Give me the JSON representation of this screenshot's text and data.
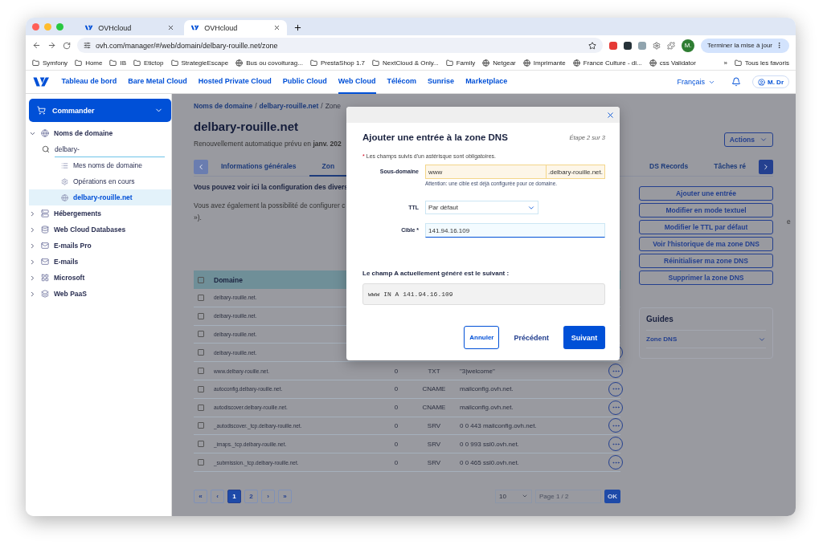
{
  "browser": {
    "tabs": [
      {
        "title": "OVHcloud",
        "selected": false
      },
      {
        "title": "OVHcloud",
        "selected": true
      }
    ],
    "url": "ovh.com/manager/#/web/domain/delbary-rouille.net/zone",
    "update_button": "Terminer la mise à jour",
    "profile_initial": "M.",
    "bookmarks": [
      {
        "label": "Symfony",
        "kind": "folder"
      },
      {
        "label": "Home",
        "kind": "folder"
      },
      {
        "label": "IB",
        "kind": "folder"
      },
      {
        "label": "Etictop",
        "kind": "folder"
      },
      {
        "label": "StrategieEscape",
        "kind": "folder"
      },
      {
        "label": "Bus ou covoiturag...",
        "kind": "site"
      },
      {
        "label": "PrestaShop 1.7",
        "kind": "folder"
      },
      {
        "label": "NextCloud & Only...",
        "kind": "folder"
      },
      {
        "label": "Family",
        "kind": "folder"
      },
      {
        "label": "Netgear",
        "kind": "site"
      },
      {
        "label": "Imprimante",
        "kind": "site"
      },
      {
        "label": "France Culture - di...",
        "kind": "site"
      },
      {
        "label": "css Validator",
        "kind": "site"
      }
    ],
    "more_bookmarks": "»",
    "all_bookmarks": "Tous les favoris"
  },
  "nav": {
    "items": [
      {
        "label": "Tableau de bord",
        "selected": false
      },
      {
        "label": "Bare Metal Cloud",
        "selected": false
      },
      {
        "label": "Hosted Private Cloud",
        "selected": false
      },
      {
        "label": "Public Cloud",
        "selected": false
      },
      {
        "label": "Web Cloud",
        "selected": true
      },
      {
        "label": "Télécom",
        "selected": false
      },
      {
        "label": "Sunrise",
        "selected": false
      },
      {
        "label": "Marketplace",
        "selected": false
      }
    ],
    "language": "Français",
    "user": "M. Dr"
  },
  "sidebar": {
    "order_button": "Commander",
    "items": [
      {
        "label": "Noms de domaine",
        "expanded": true,
        "search_value": "delbary-",
        "children": [
          {
            "label": "Mes noms de domaine",
            "selected": false
          },
          {
            "label": "Opérations en cours",
            "selected": false
          },
          {
            "label": "delbary-rouille.net",
            "selected": true
          }
        ]
      },
      {
        "label": "Hébergements",
        "expanded": false
      },
      {
        "label": "Web Cloud Databases",
        "expanded": false
      },
      {
        "label": "E-mails Pro",
        "expanded": false
      },
      {
        "label": "E-mails",
        "expanded": false
      },
      {
        "label": "Microsoft",
        "expanded": false
      },
      {
        "label": "Web PaaS",
        "expanded": false
      }
    ]
  },
  "breadcrumb": {
    "items": [
      "Noms de domaine",
      "delbary-rouille.net",
      "Zone"
    ],
    "separator": "/"
  },
  "title": "delbary-rouille.net",
  "renewal": "Renouvellement automatique prévu en **janv. 202**",
  "actions_button": "Actions",
  "tabs": [
    {
      "label": "Informations générales",
      "selected": false
    },
    {
      "label": "Zon",
      "selected": true
    },
    {
      "label": "DS Records",
      "selected": false
    },
    {
      "label": "Tâches ré",
      "selected": false
    }
  ],
  "intro_bold": "Vous pouvez voir ici la configuration des divers",
  "intro_text": "Vous avez également la possibilité de configurer c",
  "intro_text_end": "»).",
  "intro_right": "e",
  "table": {
    "columns": [
      "Domaine"
    ],
    "header_checked": false,
    "rows": [
      {
        "domain": "delbary-rouille.net.",
        "checked": false,
        "menu": false
      },
      {
        "domain": "delbary-rouille.net.",
        "checked": false,
        "menu": false
      },
      {
        "domain": "delbary-rouille.net.",
        "checked": false,
        "menu": false
      },
      {
        "domain": "delbary-rouille.net.",
        "checked": false,
        "menu": true
      },
      {
        "domain": "www.delbary-rouille.net.",
        "ttl": "0",
        "type": "TXT",
        "target": "\"3|welcome\"",
        "checked": false,
        "menu": true
      },
      {
        "domain": "autoconfig.delbary-rouille.net.",
        "ttl": "0",
        "type": "CNAME",
        "target": "mailconfig.ovh.net.",
        "checked": false,
        "menu": true
      },
      {
        "domain": "autodiscover.delbary-rouille.net.",
        "ttl": "0",
        "type": "CNAME",
        "target": "mailconfig.ovh.net.",
        "checked": false,
        "menu": true
      },
      {
        "domain": "_autodiscover._tcp.delbary-rouille.net.",
        "ttl": "0",
        "type": "SRV",
        "target": "0 0 443 mailconfig.ovh.net.",
        "checked": false,
        "menu": true
      },
      {
        "domain": "_imaps._tcp.delbary-rouille.net.",
        "ttl": "0",
        "type": "SRV",
        "target": "0 0 993 ssl0.ovh.net.",
        "checked": false,
        "menu": true
      },
      {
        "domain": "_submission._tcp.delbary-rouille.net.",
        "ttl": "0",
        "type": "SRV",
        "target": "0 0 465 ssl0.ovh.net.",
        "checked": false,
        "menu": true
      }
    ]
  },
  "pagination": {
    "pages": [
      {
        "label": "«",
        "selected": false
      },
      {
        "label": "‹",
        "selected": false
      },
      {
        "label": "1",
        "selected": true
      },
      {
        "label": "2",
        "selected": false
      },
      {
        "label": "›",
        "selected": false
      },
      {
        "label": "»",
        "selected": false
      }
    ],
    "page_size": "10",
    "page_placeholder": "Page 1 / 2",
    "go_button": "OK"
  },
  "side_actions": [
    "Ajouter une entrée",
    "Modifier en mode textuel",
    "Modifier le TTL par défaut",
    "Voir l'historique de ma zone DNS",
    "Réinitialiser ma zone DNS",
    "Supprimer la zone DNS"
  ],
  "guides": {
    "title": "Guides",
    "items": [
      "Zone DNS"
    ]
  },
  "modal": {
    "title": "Ajouter une entrée à la zone DNS",
    "step": "Étape 2 sur 3",
    "required_mark": "*",
    "required_note": "Les champs suivis d'un astérisque sont obligatoires.",
    "subdomain_label": "Sous-domaine",
    "subdomain_value": "www",
    "subdomain_suffix": ".delbary-rouille.net.",
    "subdomain_warning": "Attention: une cible est déjà configurée pour ce domaine.",
    "ttl_label": "TTL",
    "ttl_value": "Par défaut",
    "target_label": "Cible *",
    "target_value": "141.94.16.109",
    "generated_heading": "Le champ A actuellement généré est le suivant :",
    "generated_record": "www IN A 141.94.16.109",
    "buttons": [
      "Annuler",
      "Précédent",
      "Suivant"
    ]
  }
}
